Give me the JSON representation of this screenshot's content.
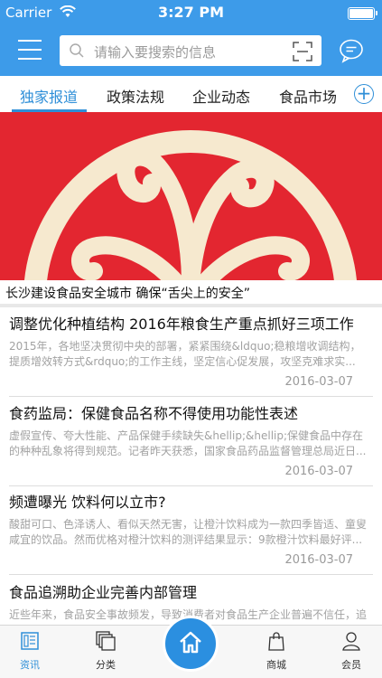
{
  "status_bar": {
    "carrier": "Carrier",
    "time": "3:27 PM"
  },
  "search": {
    "placeholder": "请输入要搜索的信息"
  },
  "tabs": [
    {
      "label": "独家报道",
      "active": true
    },
    {
      "label": "政策法规",
      "active": false
    },
    {
      "label": "企业动态",
      "active": false
    },
    {
      "label": "食品市场",
      "active": false
    }
  ],
  "hero": {
    "caption": "长沙建设食品安全城市 确保“舌尖上的安全”"
  },
  "news": [
    {
      "title": "调整优化种植结构 2016年粮食生产重点抓好三项工作",
      "summary": "2015年，各地坚决贯彻中央的部署，紧紧围绕&ldquo;稳粮增收调结构，提质增效转方式&rdquo;的工作主线，坚定信心促发展，攻坚克难求实...",
      "date": "2016-03-07"
    },
    {
      "title": "食药监局：保健食品名称不得使用功能性表述",
      "summary": "虚假宣传、夸大性能、产品保健手续缺失&hellip;&hellip;保健食品中存在的种种乱象将得到规范。记者昨天获悉，国家食品药品监督管理总局近日...",
      "date": "2016-03-07"
    },
    {
      "title": "频遭曝光 饮料何以立市?",
      "summary": "酸甜可口、色泽诱人、看似天然无害，让橙汁饮料成为一款四季皆适、童叟咸宜的饮品。然而优格对橙汁饮料的测评结果显示：9款橙汁饮料最好评...",
      "date": "2016-03-07"
    },
    {
      "title": "食品追溯助企业完善内部管理",
      "summary": "近些年来，食品安全事故频发，导致消费者对食品生产企业普遍不信任，追溯...",
      "date": ""
    }
  ],
  "tabbar": [
    {
      "label": "资讯",
      "icon": "news-icon",
      "active": true
    },
    {
      "label": "分类",
      "icon": "category-icon",
      "active": false
    },
    {
      "label": "",
      "icon": "home-icon",
      "active": false
    },
    {
      "label": "商城",
      "icon": "shopping-bag-icon",
      "active": false
    },
    {
      "label": "会员",
      "icon": "user-icon",
      "active": false
    }
  ],
  "colors": {
    "primary": "#3d9be9",
    "accent": "#2f8fd8",
    "hero_red": "#e32630"
  }
}
